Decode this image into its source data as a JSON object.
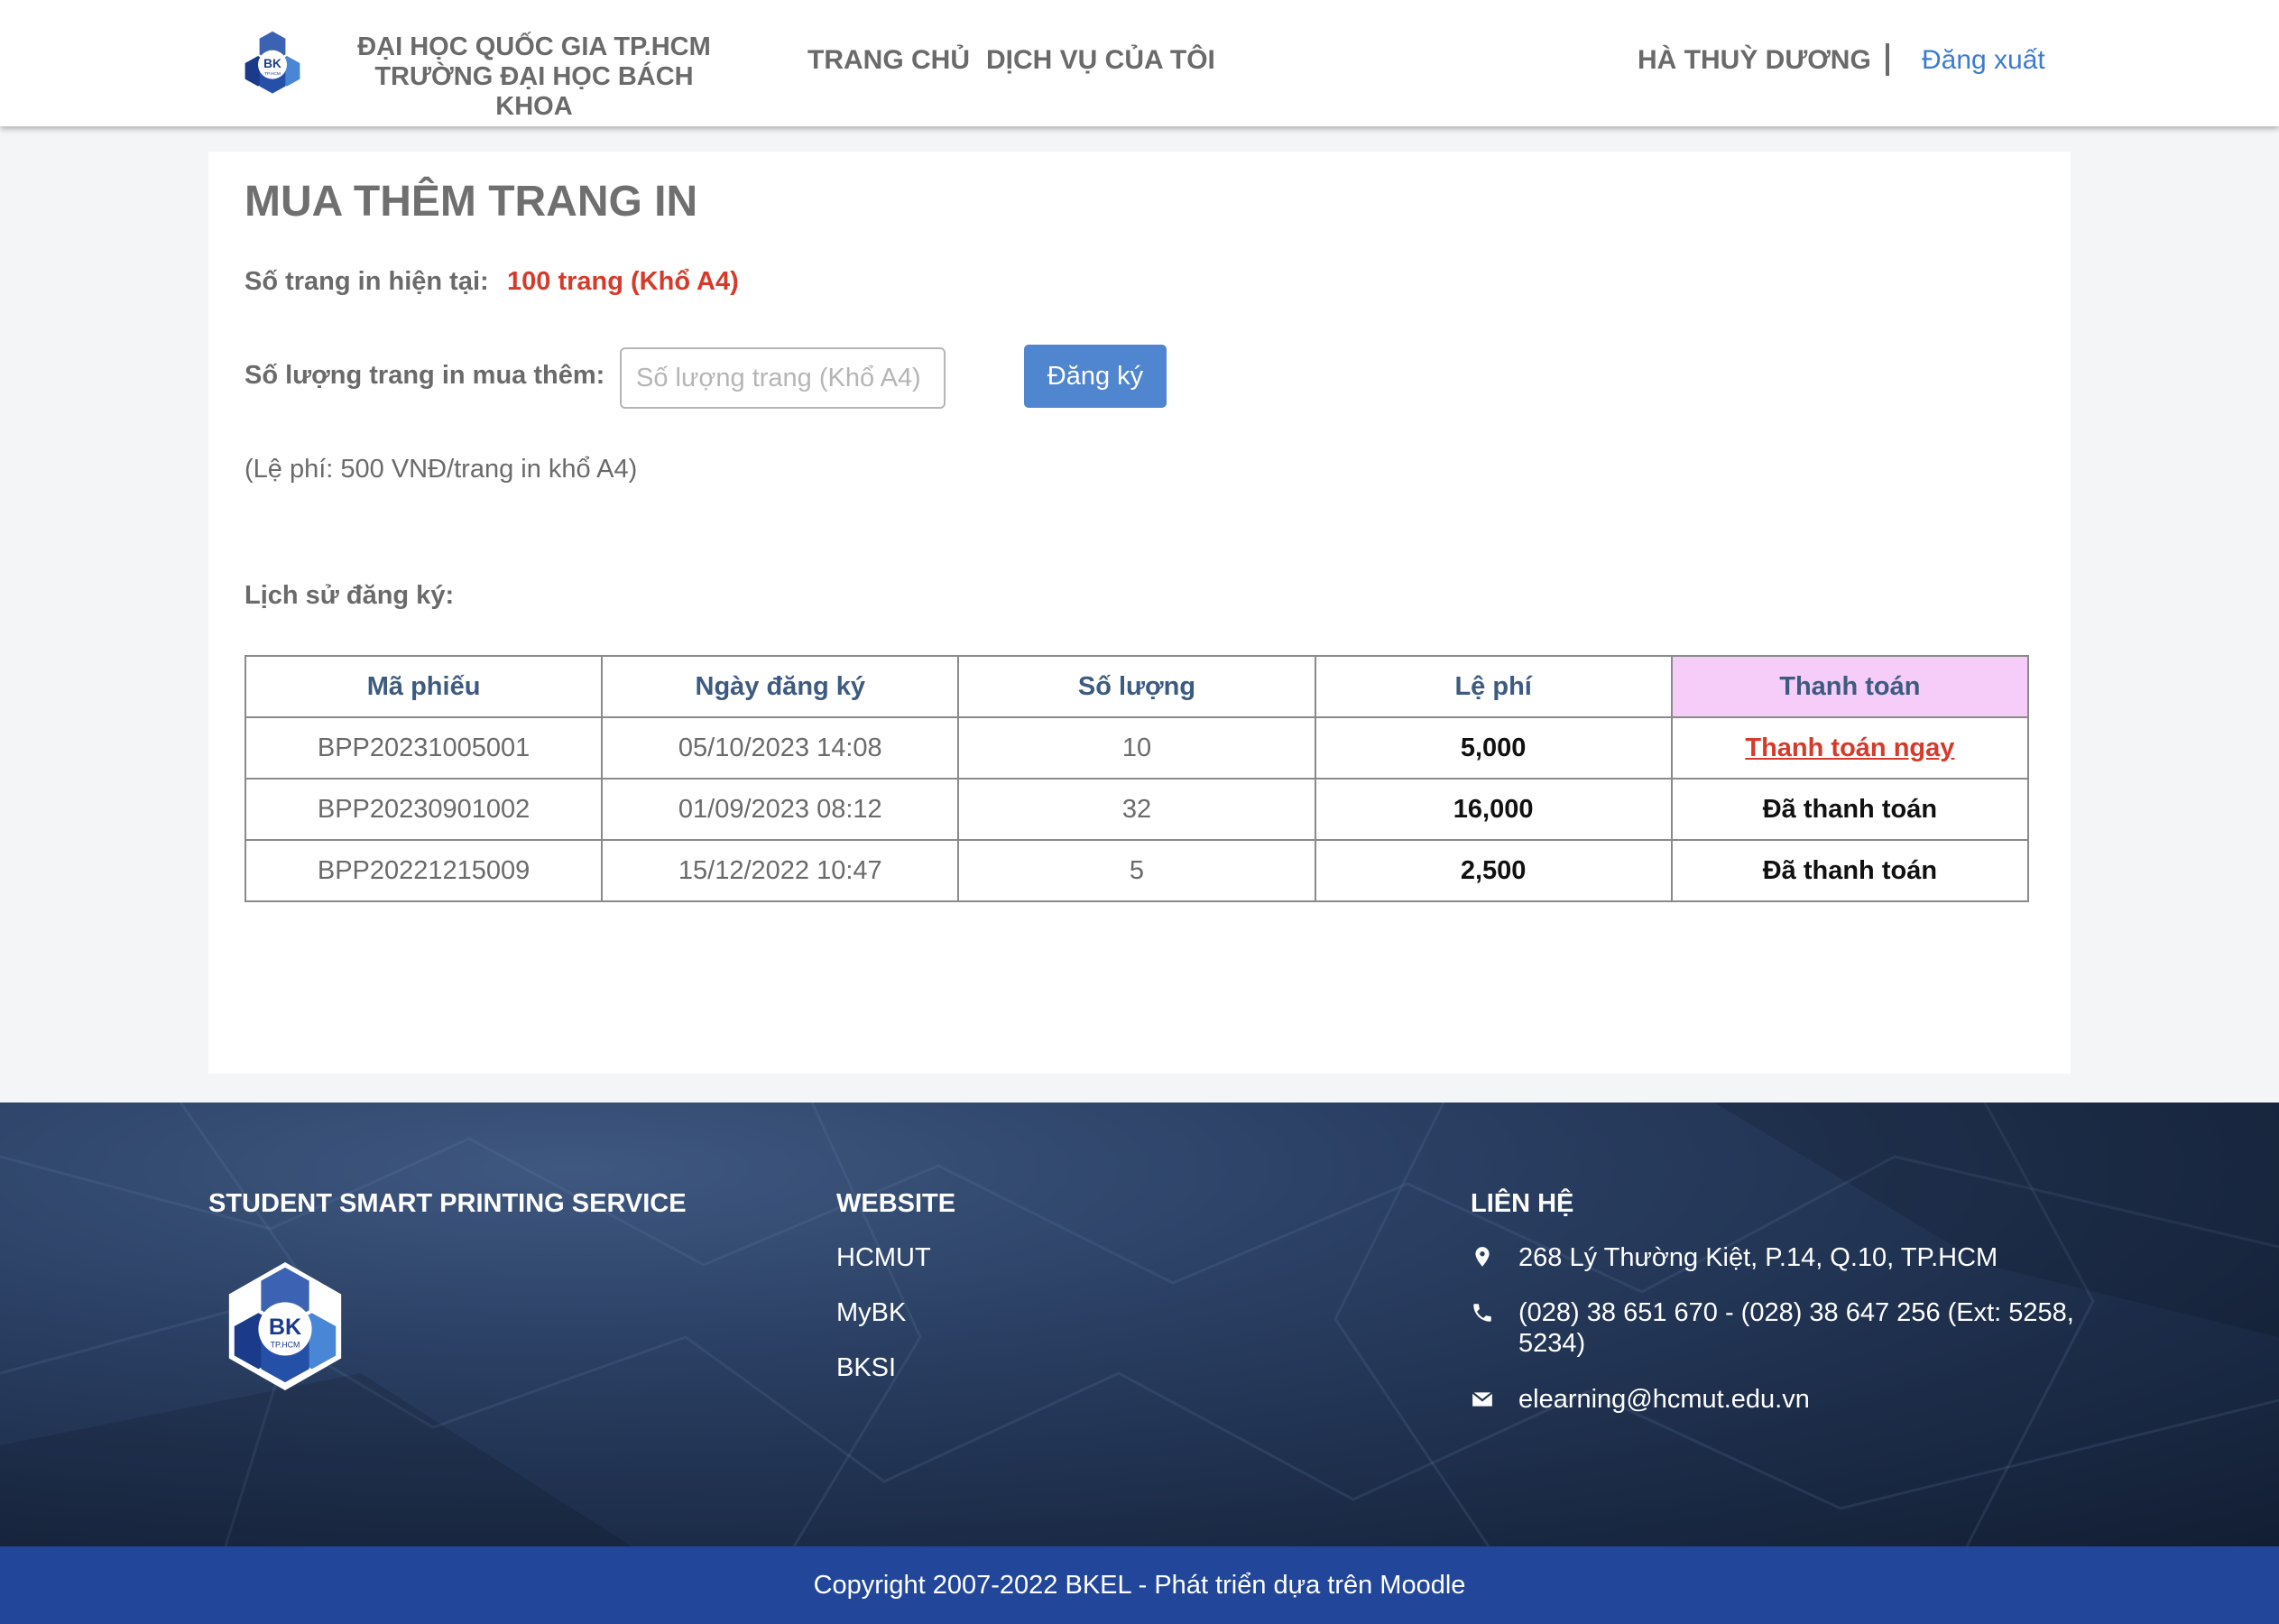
{
  "header": {
    "uni_line1": "ĐẠI HỌC QUỐC GIA TP.HCM",
    "uni_line2": "TRƯỜNG ĐẠI HỌC BÁCH KHOA",
    "logo_text": "BK",
    "logo_subtext": "TP.HCM",
    "nav": [
      "TRANG CHỦ",
      "DỊCH VỤ CỦA TÔI"
    ],
    "user_name": "HÀ THUỲ DƯƠNG",
    "logout_label": "Đăng xuất"
  },
  "main": {
    "title": "MUA THÊM TRANG IN",
    "current_label": "Số trang in hiện tại:",
    "current_value": "100 trang (Khổ A4)",
    "buy_label": "Số lượng trang in mua thêm:",
    "qty_placeholder": "Số lượng trang (Khổ A4)",
    "qty_value": "",
    "register_label": "Đăng ký",
    "fee_note": "(Lệ phí: 500 VNĐ/trang in khổ  A4)",
    "history_label": "Lịch sử đăng ký:",
    "table": {
      "headers": [
        "Mã phiếu",
        "Ngày đăng ký",
        "Số lượng",
        "Lệ phí",
        "Thanh toán"
      ],
      "rows": [
        {
          "code": "BPP20231005001",
          "date": "05/10/2023 14:08",
          "qty": "10",
          "fee": "5,000",
          "status": "Thanh toán ngay"
        },
        {
          "code": "BPP20230901002",
          "date": "01/09/2023 08:12",
          "qty": "32",
          "fee": "16,000",
          "status": "Đã thanh toán"
        },
        {
          "code": "BPP20221215009",
          "date": "15/12/2022 10:47",
          "qty": "5",
          "fee": "2,500",
          "status": "Đã thanh toán"
        }
      ]
    }
  },
  "footer": {
    "col1_title": "STUDENT SMART PRINTING SERVICE",
    "col2_title": "WEBSITE",
    "links": [
      "HCMUT",
      "MyBK",
      "BKSI"
    ],
    "col3_title": "LIÊN HỆ",
    "address": "268 Lý Thường Kiệt, P.14, Q.10, TP.HCM",
    "phone": "(028) 38 651 670 - (028) 38 647 256 (Ext: 5258, 5234)",
    "email": "elearning@hcmut.edu.vn",
    "icons": [
      "map-pin-icon",
      "phone-icon",
      "envelope-icon"
    ]
  },
  "copyright": "Copyright 2007-2022 BKEL - Phát triển dựa trên Moodle",
  "colors": {
    "accent_blue": "#4f86cf",
    "alert_red": "#d63a2a",
    "pay_header_bg": "#f5cdf8",
    "copyright_bar": "#22479a",
    "header_text_blue": "#3d5a80"
  }
}
